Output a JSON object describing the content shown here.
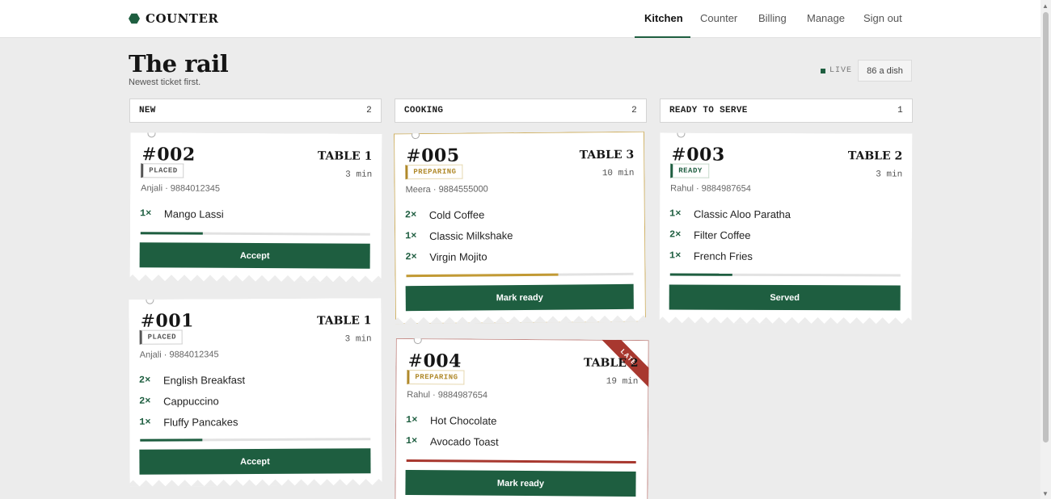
{
  "brand": {
    "name": "COUNTER",
    "icon": "hexagon-icon"
  },
  "nav": {
    "kitchen": "Kitchen",
    "counter": "Counter",
    "billing": "Billing",
    "manage": "Manage",
    "signout": "Sign out"
  },
  "page": {
    "title": "The rail",
    "subtitle": "Newest ticket first.",
    "live": "LIVE",
    "dish_button": "86 a dish"
  },
  "columns": [
    {
      "label": "NEW",
      "count": "2"
    },
    {
      "label": "COOKING",
      "count": "2"
    },
    {
      "label": "READY TO SERVE",
      "count": "1"
    }
  ],
  "tickets": {
    "t002": {
      "hash": "#",
      "num": "002",
      "table": "TABLE 1",
      "minutes": "3 min",
      "status": "PLACED",
      "customer": "Anjali · 9884012345",
      "items": [
        {
          "qty": "1×",
          "name": "Mango Lassi"
        }
      ],
      "progress": 0.27,
      "action": "Accept"
    },
    "t001": {
      "hash": "#",
      "num": "001",
      "table": "TABLE 1",
      "minutes": "3 min",
      "status": "PLACED",
      "customer": "Anjali · 9884012345",
      "items": [
        {
          "qty": "2×",
          "name": "English Breakfast"
        },
        {
          "qty": "2×",
          "name": "Cappuccino"
        },
        {
          "qty": "1×",
          "name": "Fluffy Pancakes"
        }
      ],
      "progress": 0.27,
      "action": "Accept"
    },
    "t005": {
      "hash": "#",
      "num": "005",
      "table": "TABLE 3",
      "minutes": "10 min",
      "status": "PREPARING",
      "customer": "Meera · 9884555000",
      "items": [
        {
          "qty": "2×",
          "name": "Cold Coffee"
        },
        {
          "qty": "1×",
          "name": "Classic Milkshake"
        },
        {
          "qty": "2×",
          "name": "Virgin Mojito"
        }
      ],
      "progress": 0.67,
      "action": "Mark ready"
    },
    "t004": {
      "hash": "#",
      "num": "004",
      "table": "TABLE 2",
      "minutes": "19 min",
      "status": "PREPARING",
      "customer": "Rahul · 9884987654",
      "flag": "LATE",
      "items": [
        {
          "qty": "1×",
          "name": "Hot Chocolate"
        },
        {
          "qty": "1×",
          "name": "Avocado Toast"
        }
      ],
      "progress": 1.0,
      "action": "Mark ready"
    },
    "t003": {
      "hash": "#",
      "num": "003",
      "table": "TABLE 2",
      "minutes": "3 min",
      "status": "READY",
      "customer": "Rahul · 9884987654",
      "items": [
        {
          "qty": "1×",
          "name": "Classic Aloo Paratha"
        },
        {
          "qty": "2×",
          "name": "Filter Coffee"
        },
        {
          "qty": "1×",
          "name": "French Fries"
        }
      ],
      "progress": 0.27,
      "action": "Served"
    }
  },
  "colors": {
    "brand_green": "#1e5e40",
    "preparing_gold": "#c29a34",
    "late_red": "#a8382f",
    "background": "#ececec"
  }
}
